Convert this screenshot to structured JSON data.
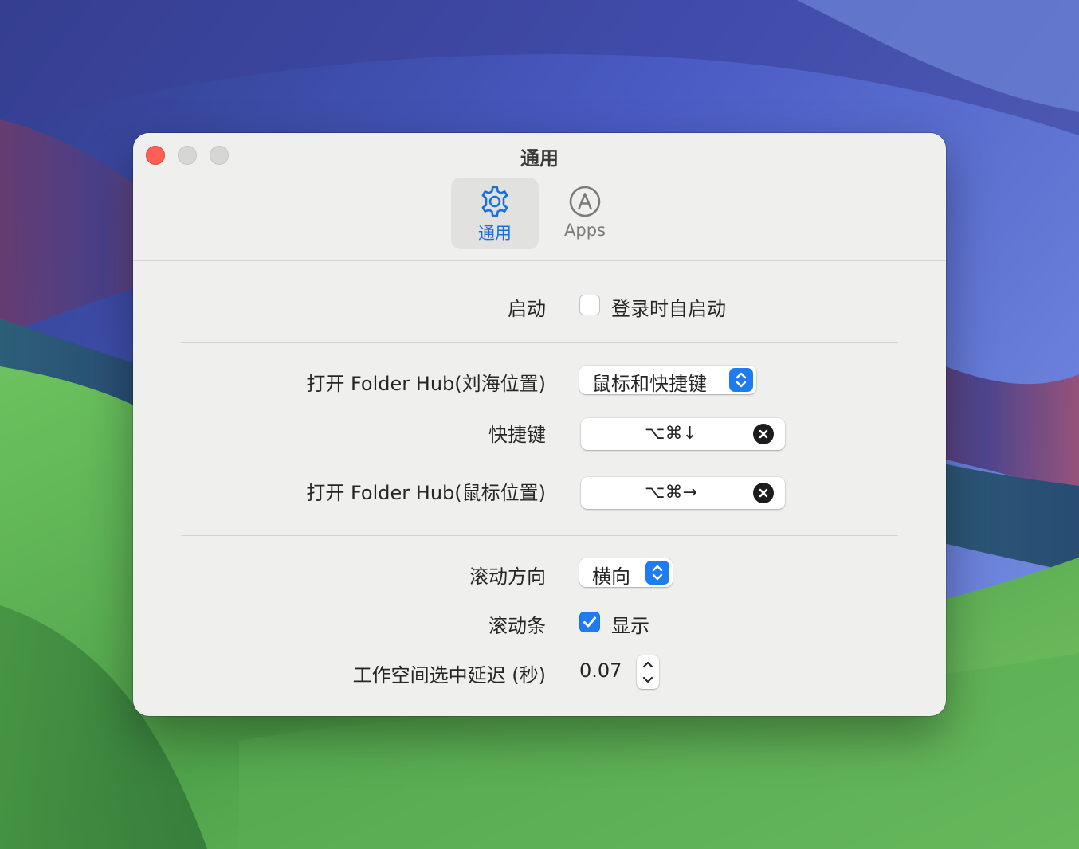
{
  "window": {
    "title": "通用"
  },
  "toolbar": {
    "tabs": [
      {
        "label": "通用",
        "icon": "gear-icon",
        "selected": true
      },
      {
        "label": "Apps",
        "icon": "app-store-icon",
        "selected": false
      }
    ]
  },
  "settings": {
    "startup": {
      "label": "启动",
      "checkbox_label": "登录时自启动",
      "checked": false
    },
    "open_notch": {
      "label": "打开 Folder Hub(刘海位置)",
      "value": "鼠标和快捷键"
    },
    "shortcut": {
      "label": "快捷键",
      "keys": "⌥⌘↓"
    },
    "open_mouse": {
      "label": "打开 Folder Hub(鼠标位置)",
      "keys": "⌥⌘→"
    },
    "scroll_direction": {
      "label": "滚动方向",
      "value": "横向"
    },
    "scrollbar": {
      "label": "滚动条",
      "checkbox_label": "显示",
      "checked": true
    },
    "workspace_delay": {
      "label": "工作空间选中延迟 (秒)",
      "value": "0.07"
    }
  },
  "colors": {
    "accent": "#1e7bf0",
    "close_button": "#fe5f57",
    "window_bg": "#efefee"
  }
}
